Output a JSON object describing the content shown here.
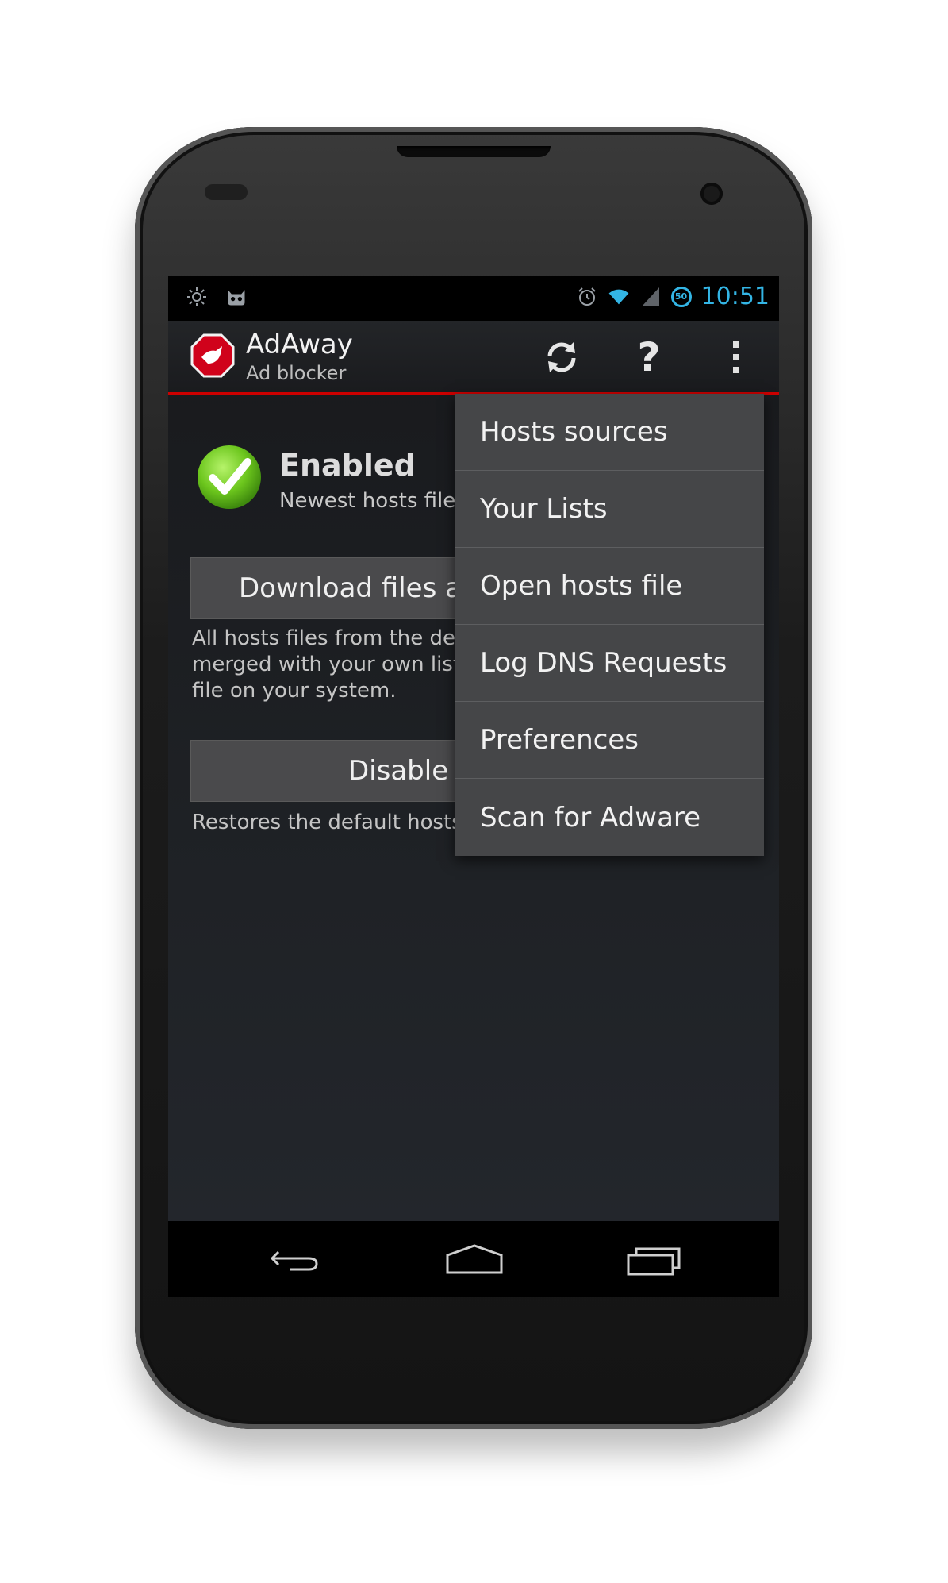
{
  "status_bar": {
    "time": "10:51",
    "battery_level": "50",
    "left_icons": [
      "brightness-icon",
      "cyanogenmod-icon"
    ],
    "right_icons": [
      "alarm-icon",
      "wifi-icon",
      "signal-icon",
      "battery-icon"
    ]
  },
  "action_bar": {
    "title": "AdAway",
    "subtitle": "Ad blocker",
    "help_label": "?",
    "accent_color": "#cc0000"
  },
  "status": {
    "title": "Enabled",
    "subtitle": "Newest hosts files"
  },
  "buttons": {
    "download_label": "Download files an",
    "disable_label": "Disable "
  },
  "help": {
    "download_text": "All hosts files from the def\nmerged with your own lists\nfile on your system.",
    "disable_text": "Restores the default hosts"
  },
  "menu": {
    "items": [
      {
        "label": "Hosts sources"
      },
      {
        "label": "Your Lists"
      },
      {
        "label": "Open hosts file"
      },
      {
        "label": "Log DNS Requests"
      },
      {
        "label": "Preferences"
      },
      {
        "label": "Scan for Adware"
      }
    ]
  },
  "colors": {
    "holo_blue": "#33b5e5",
    "check_green": "#6cc61d"
  }
}
